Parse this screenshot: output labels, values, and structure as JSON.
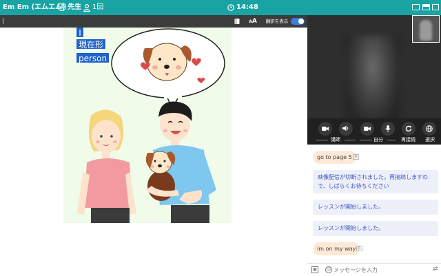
{
  "topbar": {
    "teacher": "Em Em (エムエム) 先生",
    "info_glyph": "i",
    "lesson_count": "1回",
    "clock": "14:48",
    "accent": "#19a3a3"
  },
  "toolbar": {
    "font_size_label": "A",
    "font_size_label_big": "A",
    "translate_label": "翻訳を表示",
    "translate_on": true
  },
  "slide": {
    "tags": [
      "I",
      "現在形",
      "person"
    ]
  },
  "controls": {
    "labels": {
      "teacher": "講師",
      "self": "自分",
      "reconnect": "再接続",
      "select": "選択"
    }
  },
  "chat": {
    "messages": [
      {
        "kind": "user",
        "text": "go to page 5"
      },
      {
        "kind": "system",
        "text": "映像配信が切断されました。再接続しますので、しばらくお待ちください"
      },
      {
        "kind": "system",
        "text": "レッスンが開始しました。"
      },
      {
        "kind": "system",
        "text": "レッスンが開始しました。"
      },
      {
        "kind": "user",
        "text": "im on my way"
      }
    ],
    "input_placeholder": "メッセージを入力"
  }
}
